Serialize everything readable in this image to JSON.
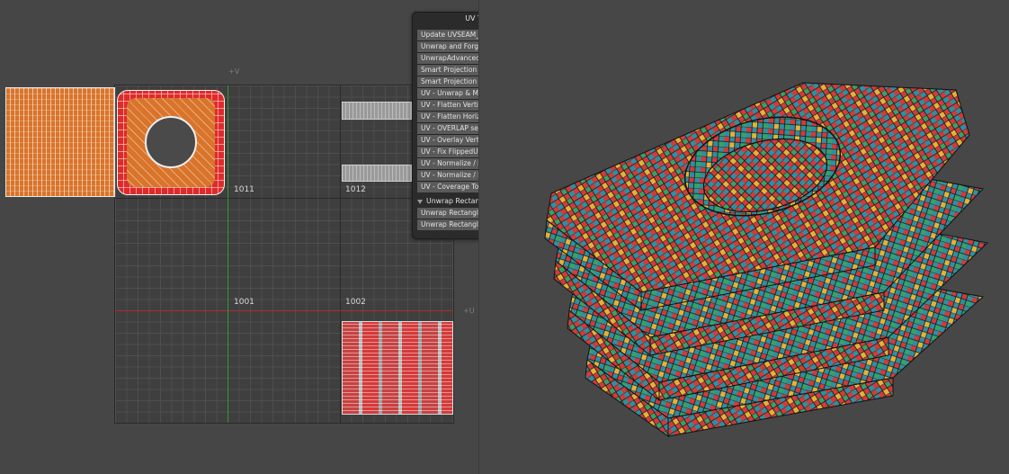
{
  "uv_editor": {
    "udim_labels": {
      "t1011": "1011",
      "t1012": "1012",
      "t1001": "1001",
      "t1002": "1002"
    },
    "axis_tags": {
      "top": "+V",
      "right": "+U"
    }
  },
  "uv_tools": {
    "title": "UV Tools",
    "buttons": [
      "Update UVSEAM_SelSet",
      "Unwrap and Forget",
      "UnwrapAdvanced",
      "Smart Projection / Unwrap",
      "Smart Projection Cylindrical",
      "UV - Unwrap & Move to Side Left",
      "UV - Flatten Vertical Edges",
      "UV - Flatten Horizontal Edges",
      "UV - OVERLAP selection",
      "UV - Overlay Vertex",
      "UV - Fix FlippedUV Island on U",
      "UV - Normalize / Pack",
      "UV - Normalize / Pack / Set TD",
      "UV - Coverage Toggle"
    ],
    "section": {
      "label": "Unwrap Rectangle Poly Selection",
      "buttons": [
        "Unwrap Rectangle Horizontal",
        "Unwrap Rectangle Vertical"
      ]
    }
  },
  "colors": {
    "viewport_bg": "#464646",
    "panel_bg": "#2b2b2b",
    "button_bg": "#5a5a5a",
    "u_axis": "#b02a2a",
    "v_axis": "#2f9a2f",
    "checker": [
      "#d13b3b",
      "#2f8fa0",
      "#e2b23a",
      "#3aa06a"
    ]
  }
}
